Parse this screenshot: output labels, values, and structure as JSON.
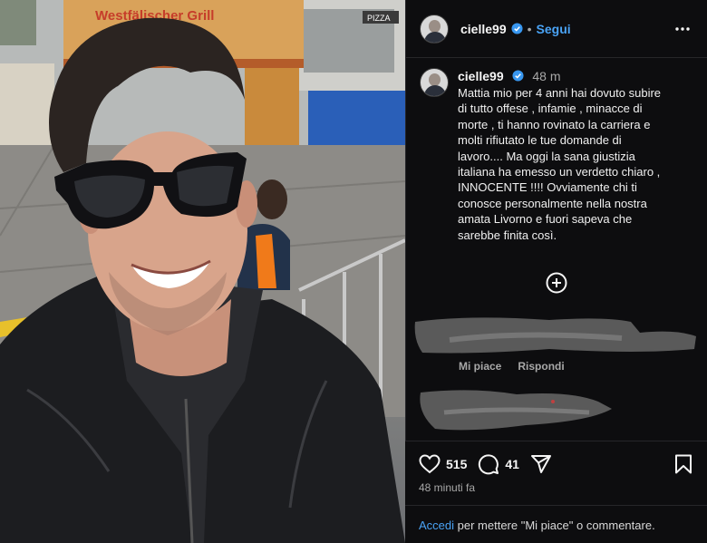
{
  "post": {
    "username": "cielle99",
    "dot": "•",
    "follow_label": "Segui",
    "caption_time": "48 m",
    "caption_text": "Mattia mio per 4 anni hai dovuto subire\ndi tutto offese , infamie , minacce di\nmorte , ti hanno rovinato la carriera e\nmolti rifiutato le tue domande di\nlavoro.... Ma oggi la sana giustizia\nitaliana ha emesso un verdetto chiaro ,\nINNOCENTE !!!! Ovviamente  chi ti\nconosce personalmente nella nostra\namata Livorno e fuori sapeva che\nsarebbe finita così."
  },
  "photo": {
    "sign_text": "Westfälischer Grill",
    "pizza_text": "PIZZA"
  },
  "comments": {
    "like_label": "Mi piace",
    "reply_label": "Rispondi"
  },
  "actions": {
    "likes": "515",
    "comments": "41",
    "time_ago": "48 minuti fa",
    "login_link": "Accedi",
    "login_text": " per mettere \"Mi piace\" o commentare."
  },
  "icons": {
    "more": "more-horizontal-icon",
    "verified": "verified-badge-icon",
    "like": "heart-icon",
    "comment": "comment-bubble-icon",
    "share": "share-plane-icon",
    "save": "bookmark-icon",
    "plus": "plus-circle-icon"
  },
  "colors": {
    "accent": "#4aa3f5",
    "panel_bg": "#0d0d0f",
    "muted": "#a8a8a8"
  }
}
